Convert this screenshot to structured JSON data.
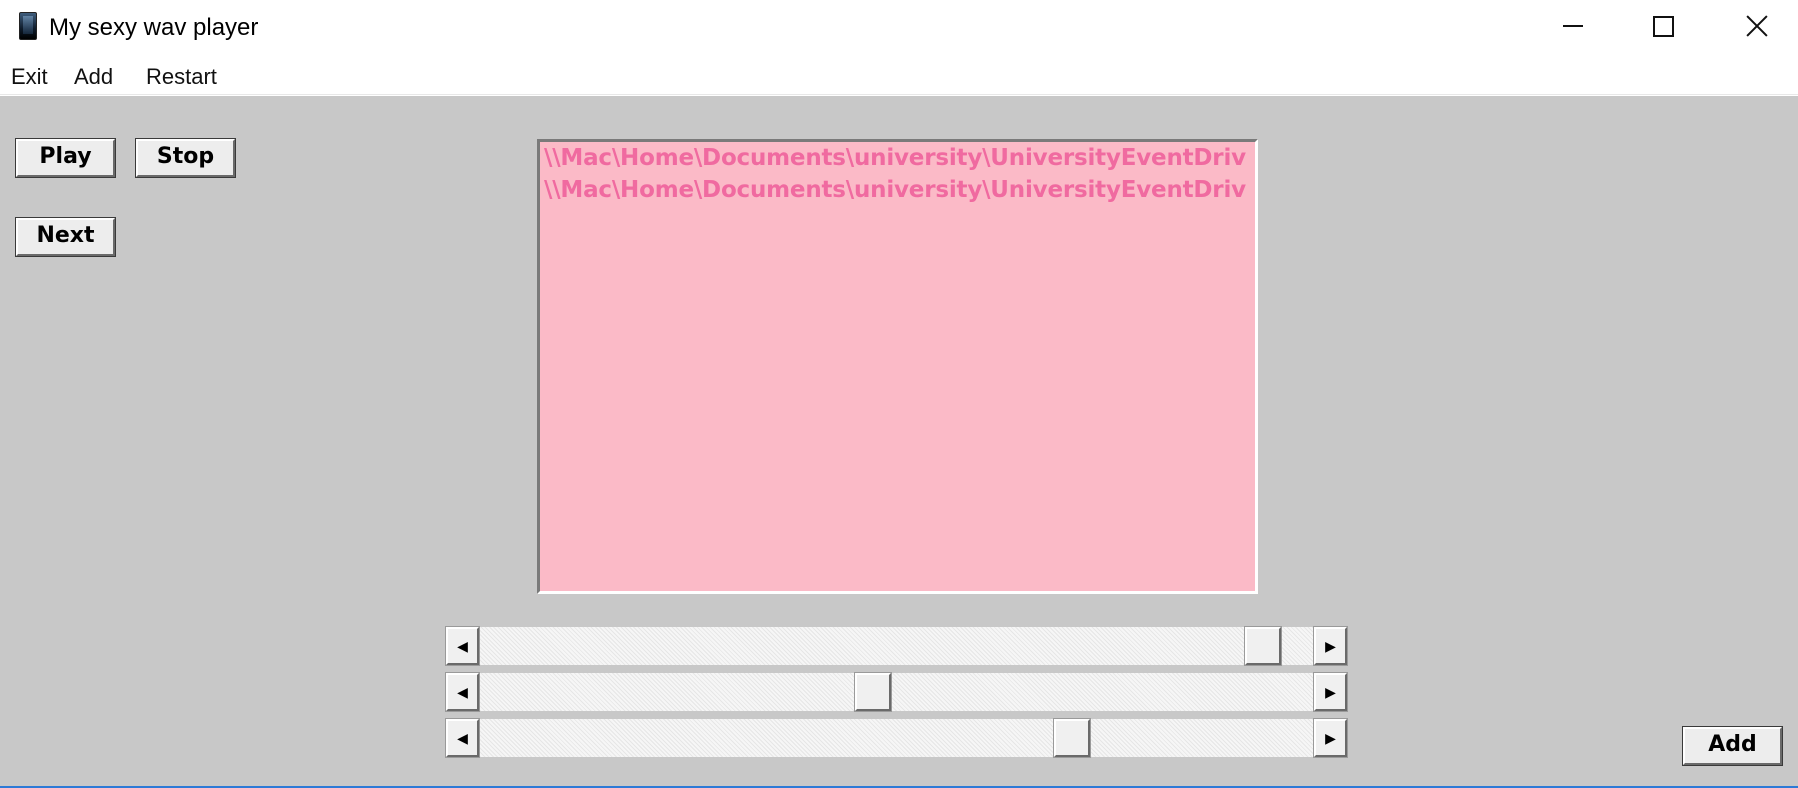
{
  "window": {
    "title": "My sexy wav player",
    "icon": "media-player-icon"
  },
  "title_buttons": {
    "minimize": "minimize-icon",
    "maximize": "maximize-icon",
    "close": "close-icon"
  },
  "menu": {
    "items": [
      {
        "label": "Exit"
      },
      {
        "label": "Add"
      },
      {
        "label": "Restart"
      }
    ]
  },
  "controls": {
    "play_label": "Play",
    "stop_label": "Stop",
    "next_label": "Next",
    "add_label": "Add"
  },
  "playlist": {
    "items": [
      "\\\\Mac\\Home\\Documents\\university\\UniversityEventDriv",
      "\\\\Mac\\Home\\Documents\\university\\UniversityEventDriv"
    ],
    "background_color": "#fbbac7",
    "text_color": "#f06aa0"
  },
  "sliders": [
    {
      "name": "position",
      "value_fraction": 0.96
    },
    {
      "name": "volume",
      "value_fraction": 0.47
    },
    {
      "name": "balance",
      "value_fraction": 0.72
    }
  ],
  "colors": {
    "client_background": "#c8c8c8",
    "accent_border": "#2d7ad6"
  }
}
